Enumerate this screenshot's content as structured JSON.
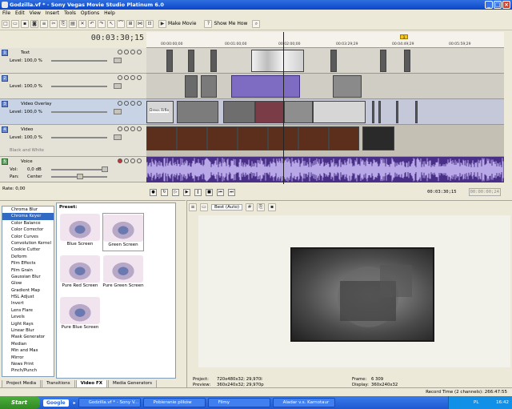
{
  "window": {
    "title": "Godzilla.vf * - Sony Vegas Movie Studio Platinum 6.0",
    "buttons": [
      "_",
      "□",
      "×"
    ]
  },
  "menu": [
    "File",
    "Edit",
    "View",
    "Insert",
    "Tools",
    "Options",
    "Help"
  ],
  "toolbar": {
    "make_movie": "Make Movie",
    "show_me_how": "Show Me How"
  },
  "timecode": "00:03:30;15",
  "ruler": {
    "ticks": [
      "00:00:00;00",
      "00:01:00;00",
      "00:02:00;00",
      "00:03:00;00",
      "00:03:29;29",
      "00:04:49;29",
      "00:05:59;29"
    ],
    "marker": "1"
  },
  "tracks": [
    {
      "num": "1",
      "name": "Text",
      "level": "Level: 100,0 %"
    },
    {
      "num": "2",
      "name": "",
      "level": "Level: 100,0 %"
    },
    {
      "num": "3",
      "name": "Video Overlay",
      "level": "Level: 100,0 %"
    },
    {
      "num": "4",
      "name": "Video",
      "level": "Level: 100,0 %"
    }
  ],
  "black_and_white": "Black and White",
  "clips": {
    "overlay_label": "Dress Rifle"
  },
  "audio": {
    "num": "5",
    "name": "Voice",
    "vol_label": "Vol:",
    "vol_value": "0,0 dB",
    "pan_label": "Pan:",
    "pan_value": "Center"
  },
  "rate": "Rate: 0,00",
  "transport": {
    "position": "00:03:30;15",
    "end": "00:00:00;24"
  },
  "fx": {
    "items": [
      "Chroma Blur",
      "Chroma Keyer",
      "Color Balance",
      "Color Corrector",
      "Color Curves",
      "Convolution Kernel",
      "Cookie Cutter",
      "Deform",
      "Film Effects",
      "Film Grain",
      "Gaussian Blur",
      "Glow",
      "Gradient Map",
      "HSL Adjust",
      "Invert",
      "Lens Flare",
      "Levels",
      "Light Rays",
      "Linear Blur",
      "Mask Generator",
      "Median",
      "Min and Max",
      "Mirror",
      "News Print",
      "Pinch/Punch"
    ],
    "selected": "Chroma Keyer",
    "preset_label": "Preset:",
    "presets": [
      "Blue Screen",
      "Green Screen",
      "Pure Red Screen",
      "Pure Green Screen",
      "Pure Blue Screen"
    ]
  },
  "tabs": [
    "Project Media",
    "Transitions",
    "Video FX",
    "Media Generators"
  ],
  "active_tab": "Video FX",
  "preview": {
    "quality": "Best (Auto)",
    "project_label": "Project:",
    "project_value": "720x480x32; 29,970i",
    "preview_label": "Preview:",
    "preview_value": "360x240x32; 29,970p",
    "frame_label": "Frame:",
    "frame_value": "6 309",
    "display_label": "Display:",
    "display_value": "360x240x32"
  },
  "status": {
    "record_time": "Record Time (2 channels): 266:47:55"
  },
  "taskbar": {
    "start": "Start",
    "google": "Google",
    "tasks": [
      "Godzilla.vf * - Sony V...",
      "Pobieranie plików",
      "Filmy",
      "Aladar v.s. Karnotaur"
    ],
    "lang": "PL",
    "clock": "16:42"
  },
  "colors": {
    "title_bar": "#0c46c8",
    "audio_wave": "#4a2f88",
    "clip_purple": "#7d6cc2",
    "selected": "#316ac5",
    "start_button": "#2f8a23"
  }
}
